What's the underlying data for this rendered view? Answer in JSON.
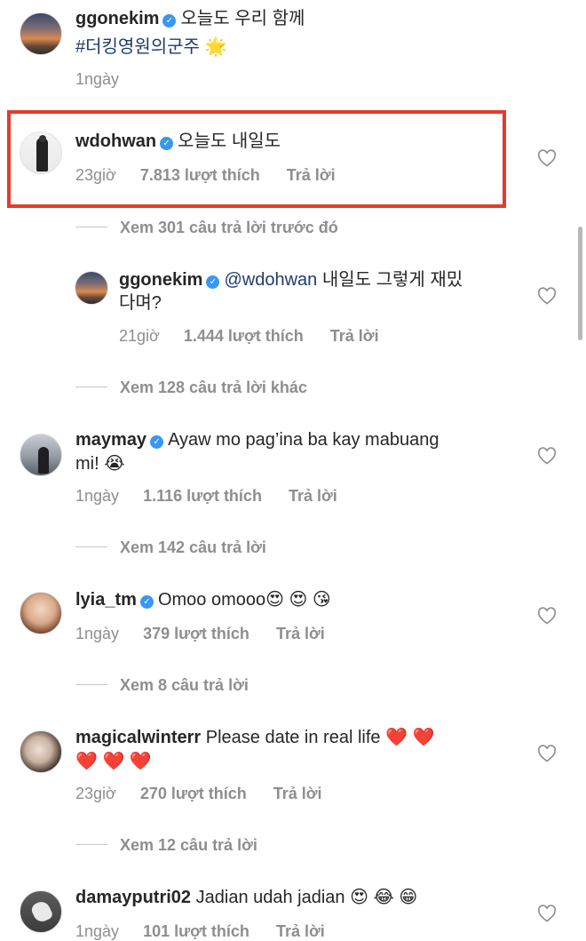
{
  "comments": [
    {
      "username": "ggonekim",
      "text": "오늘도 우리 함께",
      "hashtag": "#더킹영원의군주",
      "hashtag_emoji": "🌟",
      "time": "1ngày",
      "avatar": "sunset-avatar"
    },
    {
      "username": "wdohwan",
      "text": "오늘도 내일도",
      "time": "23giờ",
      "likes": "7.813 lượt thích",
      "reply_label": "Trả lời",
      "view_more": "Xem 301 câu trả lời trước đó",
      "highlighted": true,
      "highlight_color": "#e33b2b",
      "reply": {
        "username": "ggonekim",
        "mention": "@wdohwan",
        "text_line1": "내일도 그렇게 재밌",
        "text_line2": "다며?",
        "time": "21giờ",
        "likes": "1.444 lượt thích",
        "reply_label": "Trả lời"
      },
      "view_more_after": "Xem 128 câu trả lời khác"
    },
    {
      "username": "maymay",
      "text_line1": "Ayaw mo pag’ina ba kay mabuang",
      "text_line2": "mi! 😭",
      "time": "1ngày",
      "likes": "1.116 lượt thích",
      "reply_label": "Trả lời",
      "view_more": "Xem 142 câu trả lời"
    },
    {
      "username": "lyia_tm",
      "text": "Omoo omooo😍 😍 😘",
      "time": "1ngày",
      "likes": "379 lượt thích",
      "reply_label": "Trả lời",
      "view_more": "Xem 8 câu trả lời"
    },
    {
      "username": "magicalwinterr",
      "text_line1": "Please date in real life ❤️ ❤️",
      "text_line2": "❤️ ❤️ ❤️",
      "time": "23giờ",
      "likes": "270 lượt thích",
      "reply_label": "Trả lời",
      "view_more": "Xem 12 câu trả lời"
    },
    {
      "username": "damayputri02",
      "text": "Jadian udah jadian 😍 😂 😁",
      "time": "1ngày",
      "likes": "101 lượt thích",
      "reply_label": "Trả lời"
    }
  ],
  "icons": {
    "verified": "verified-badge-icon",
    "like": "heart-outline-icon"
  },
  "colors": {
    "link": "#1f3b6e",
    "verified": "#3897f0",
    "meta": "#8e8e8e"
  }
}
